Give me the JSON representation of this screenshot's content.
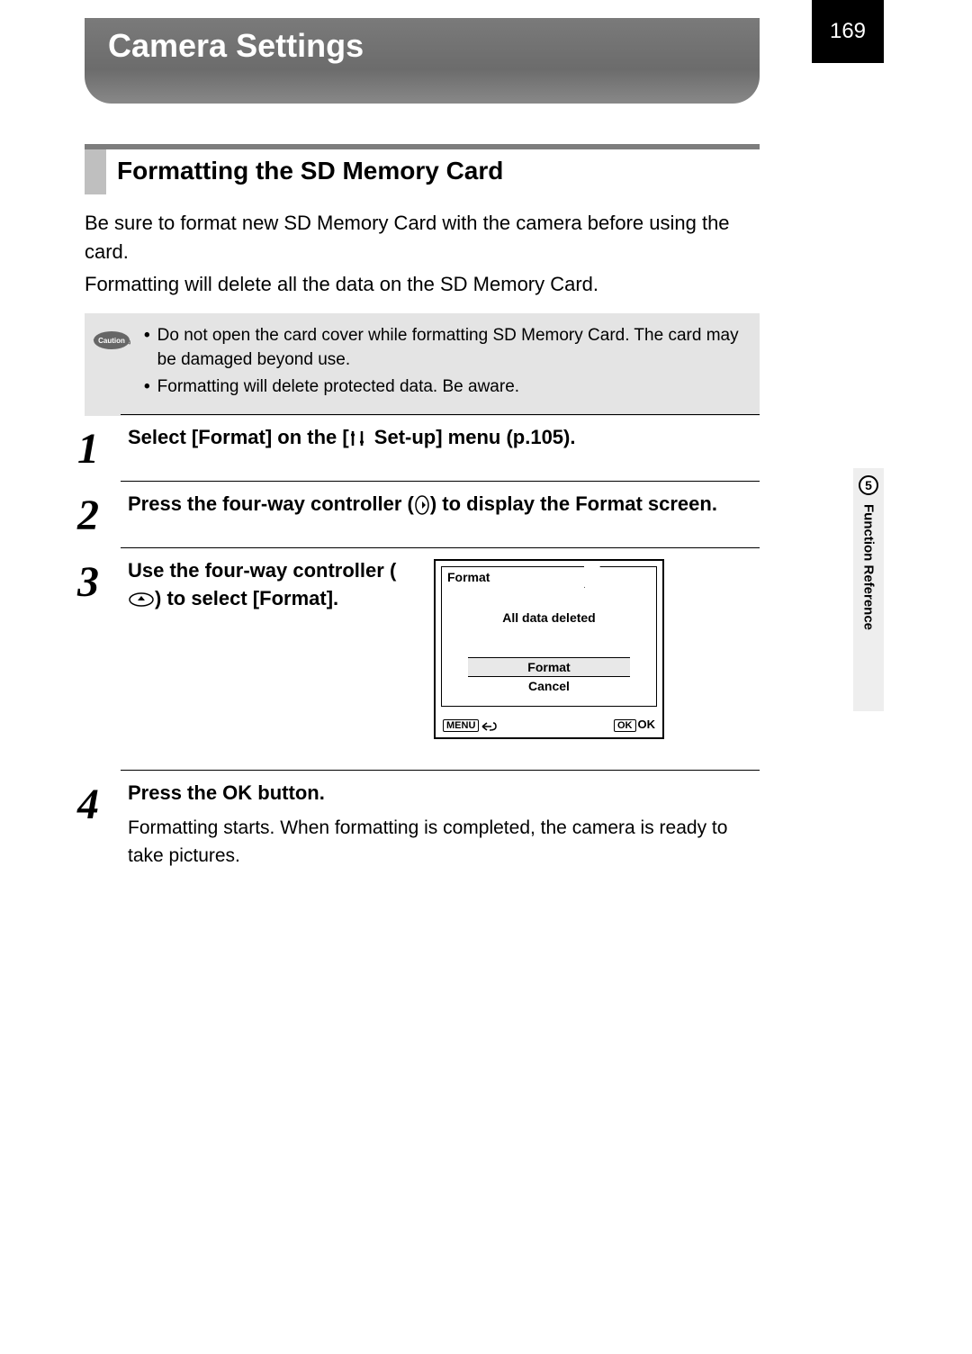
{
  "page_number": "169",
  "title": "Camera Settings",
  "section": "Formatting the SD Memory Card",
  "intro_line1": "Be sure to format new SD Memory Card with the camera before using the card.",
  "intro_line2": "Formatting will delete all the data on the SD Memory Card.",
  "caution": {
    "label": "Caution",
    "items": [
      "Do not open the card cover while formatting SD Memory Card. The card may be damaged beyond use.",
      "Formatting will delete protected data. Be aware."
    ]
  },
  "steps": [
    {
      "num": "1",
      "head_pre": "Select [Format] on the [",
      "head_post": " Set-up] menu (p.105)."
    },
    {
      "num": "2",
      "head_pre": "Press the four-way controller (",
      "head_post": ") to display the Format screen."
    },
    {
      "num": "3",
      "head_pre": "Use the four-way controller (",
      "head_post": ") to select [Format]."
    },
    {
      "num": "4",
      "head_pre": "Press the ",
      "head_mid": "OK",
      "head_post": " button.",
      "body": "Formatting starts. When formatting is completed, the camera is ready to take pictures."
    }
  ],
  "lcd": {
    "tab": "Format",
    "message": "All data deleted",
    "option_selected": "Format",
    "option_other": "Cancel",
    "footer_left_box": "MENU",
    "footer_right_box": "OK",
    "footer_right_text": "OK"
  },
  "side": {
    "chapter_num": "5",
    "chapter_label": "Function Reference"
  }
}
